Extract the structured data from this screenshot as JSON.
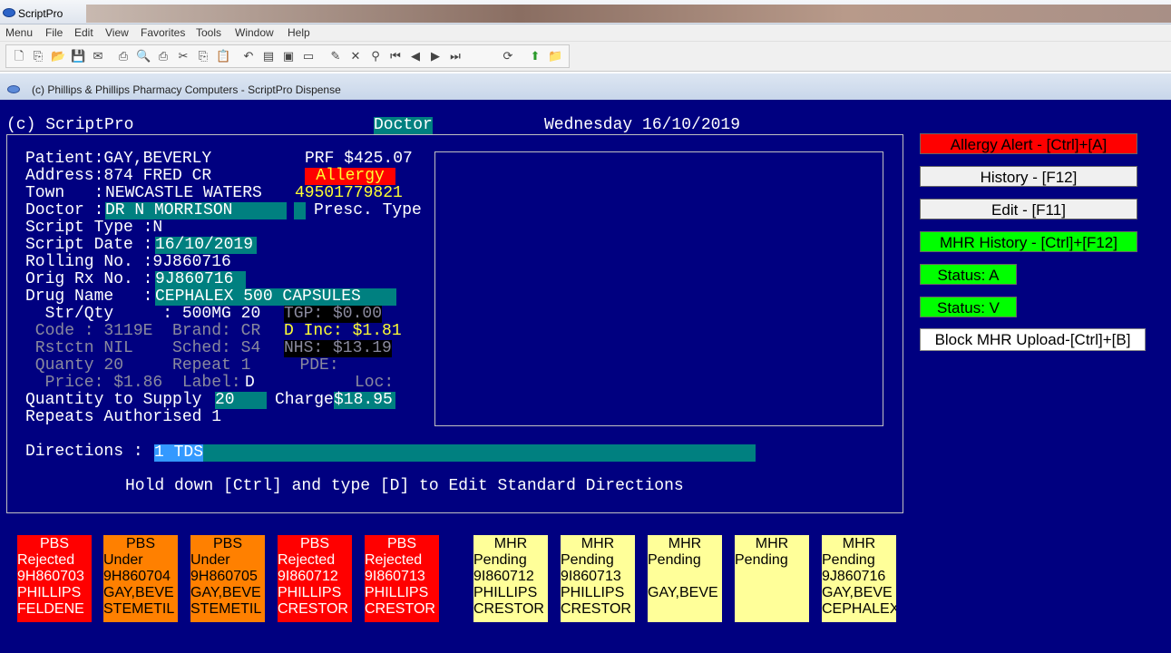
{
  "window": {
    "title": "ScriptPro"
  },
  "menu": [
    "Menu",
    "File",
    "Edit",
    "View",
    "Favorites",
    "Tools",
    "Window",
    "Help"
  ],
  "child_window": {
    "title": "(c) Phillips & Phillips Pharmacy Computers - ScriptPro Dispense"
  },
  "header": {
    "app": "(c) ScriptPro",
    "mode": "Doctor",
    "date": "Wednesday 16/10/2019"
  },
  "patient": {
    "patient_line": "Patient:GAY,BEVERLY",
    "prf": "PRF $425.07",
    "address_line": "Address:874 FRED CR",
    "allergy": "Allergy",
    "town_label": "Town   :",
    "town": "NEWCASTLE WATERS",
    "medicare": "49501779821",
    "doctor_label": "Doctor :",
    "doctor": "DR N MORRISON",
    "presc_type_label": "Presc. Type",
    "script_type_line": "Script Type :N",
    "script_date_label": "Script Date :",
    "script_date": "16/10/2019",
    "rolling_line": "Rolling No. :9J860716",
    "orig_label": "Orig Rx No. :",
    "orig_rx": "9J860716",
    "drug_label": "Drug Name   :",
    "drug": "CEPHALEX 500 CAPSULES",
    "strqty_line": "  Str/Qty     : 500MG 20",
    "tgp": "TGP: $0.00",
    "code_line": " Code : 3119E  Brand: CR",
    "dinc": "D Inc: $1.81",
    "rstctn_line": " Rstctn NIL    Sched: S4",
    "nhs": "NHS: $13.19",
    "quanty_line": " Quanty 20     Repeat 1     PDE:",
    "price_line": "  Price: $1.86  Label: ",
    "label_val": "D",
    "loc": "Loc:",
    "qty_supply_label": "Quantity to Supply ",
    "qty_supply": "20",
    "charge_label": "Charge",
    "charge": "$18.95",
    "repeats_line": "Repeats Authorised 1",
    "directions_label": "Directions : ",
    "directions": "1 TDS",
    "hint": "Hold down [Ctrl] and type [D] to Edit Standard Directions"
  },
  "side_buttons": [
    {
      "label": "Allergy Alert - [Ctrl]+[A]",
      "color": "#ff0000",
      "text": "#000000"
    },
    {
      "label": "History - [F12]",
      "color": "#f0f0f0",
      "text": "#000000"
    },
    {
      "label": "Edit - [F11]",
      "color": "#f0f0f0",
      "text": "#000000"
    },
    {
      "label": "MHR History - [Ctrl]+[F12]",
      "color": "#00ff00",
      "text": "#000000"
    },
    {
      "label": "Status: A",
      "color": "#00ff00",
      "text": "#000000"
    },
    {
      "label": "Status: V",
      "color": "#00ff00",
      "text": "#000000"
    },
    {
      "label": "Block MHR Upload-[Ctrl]+[B]",
      "color": "#ffffff",
      "text": "#000000"
    }
  ],
  "tiles": [
    {
      "type": "red",
      "lines": [
        "PBS",
        "Rejected",
        "9H860703",
        "PHILLIPS",
        "FELDENE"
      ]
    },
    {
      "type": "orange",
      "lines": [
        "PBS",
        "Under",
        "9H860704",
        "GAY,BEVE",
        "STEMETIL"
      ]
    },
    {
      "type": "orange",
      "lines": [
        "PBS",
        "Under",
        "9H860705",
        "GAY,BEVE",
        "STEMETIL"
      ]
    },
    {
      "type": "red",
      "lines": [
        "PBS",
        "Rejected",
        "9I860712",
        "PHILLIPS",
        "CRESTOR"
      ]
    },
    {
      "type": "red",
      "lines": [
        "PBS",
        "Rejected",
        "9I860713",
        "PHILLIPS",
        "CRESTOR"
      ]
    },
    {
      "type": "yellow",
      "lines": [
        "MHR",
        "Pending",
        "9I860712",
        "PHILLIPS",
        "CRESTOR"
      ]
    },
    {
      "type": "yellow",
      "lines": [
        "MHR",
        "Pending",
        "9I860713",
        "PHILLIPS",
        "CRESTOR"
      ]
    },
    {
      "type": "yellow",
      "lines": [
        "MHR",
        "Pending",
        "",
        "GAY,BEVE",
        ""
      ]
    },
    {
      "type": "yellow",
      "lines": [
        "MHR",
        "Pending",
        "",
        "",
        ""
      ]
    },
    {
      "type": "yellow",
      "lines": [
        "MHR",
        "Pending",
        "9J860716",
        "GAY,BEVE",
        "CEPHALEX"
      ]
    }
  ]
}
